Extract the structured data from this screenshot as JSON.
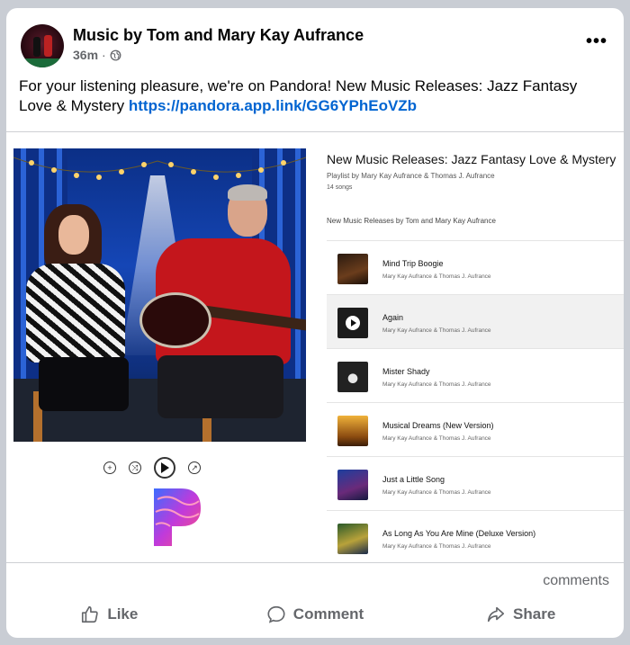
{
  "post": {
    "author": "Music by Tom and Mary Kay Aufrance",
    "time": "36m",
    "separator": "·",
    "text": "For your listening pleasure, we're on Pandora! New Music Releases: Jazz Fantasy Love & Mystery ",
    "link": "https://pandora.app.link/GG6YPhEoVZb",
    "more_label": "•••"
  },
  "playlist": {
    "title": "New Music Releases: Jazz Fantasy Love & Mystery",
    "by": "Playlist by Mary Kay Aufrance & Thomas J. Aufrance",
    "count": "14 songs",
    "subtitle": "New Music Releases by Tom and Mary Kay Aufrance",
    "tracks": [
      {
        "name": "Mind Trip Boogie",
        "artist": "Mary Kay Aufrance & Thomas J. Aufrance"
      },
      {
        "name": "Again",
        "artist": "Mary Kay Aufrance & Thomas J. Aufrance"
      },
      {
        "name": "Mister Shady",
        "artist": "Mary Kay Aufrance & Thomas J. Aufrance"
      },
      {
        "name": "Musical Dreams (New Version)",
        "artist": "Mary Kay Aufrance & Thomas J. Aufrance"
      },
      {
        "name": "Just a Little Song",
        "artist": "Mary Kay Aufrance & Thomas J. Aufrance"
      },
      {
        "name": "As Long As You Are Mine (Deluxe Version)",
        "artist": "Mary Kay Aufrance & Thomas J. Aufrance"
      }
    ]
  },
  "footer": {
    "comments": "comments",
    "like": "Like",
    "comment": "Comment",
    "share": "Share"
  },
  "colors": {
    "link": "#0064d1",
    "secondary_text": "#65676b",
    "divider": "#ced0d4"
  }
}
